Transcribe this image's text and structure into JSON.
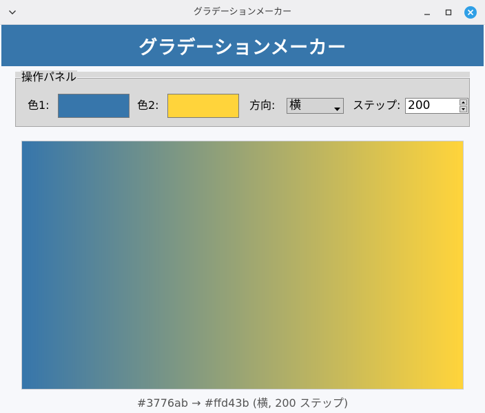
{
  "window": {
    "title": "グラデーションメーカー"
  },
  "header": {
    "title": "グラデーションメーカー",
    "background": "#3776ab"
  },
  "panel": {
    "label": "操作パネル",
    "color1_label": "色1:",
    "color2_label": "色2:",
    "direction_label": "方向:",
    "direction_value": "横",
    "steps_label": "ステップ:",
    "steps_value": "200"
  },
  "gradient": {
    "color1": "#3776ab",
    "color2": "#ffd43b",
    "direction": "horizontal",
    "steps": 200
  },
  "status": {
    "text": "#3776ab → #ffd43b  (横, 200 ステップ)"
  }
}
